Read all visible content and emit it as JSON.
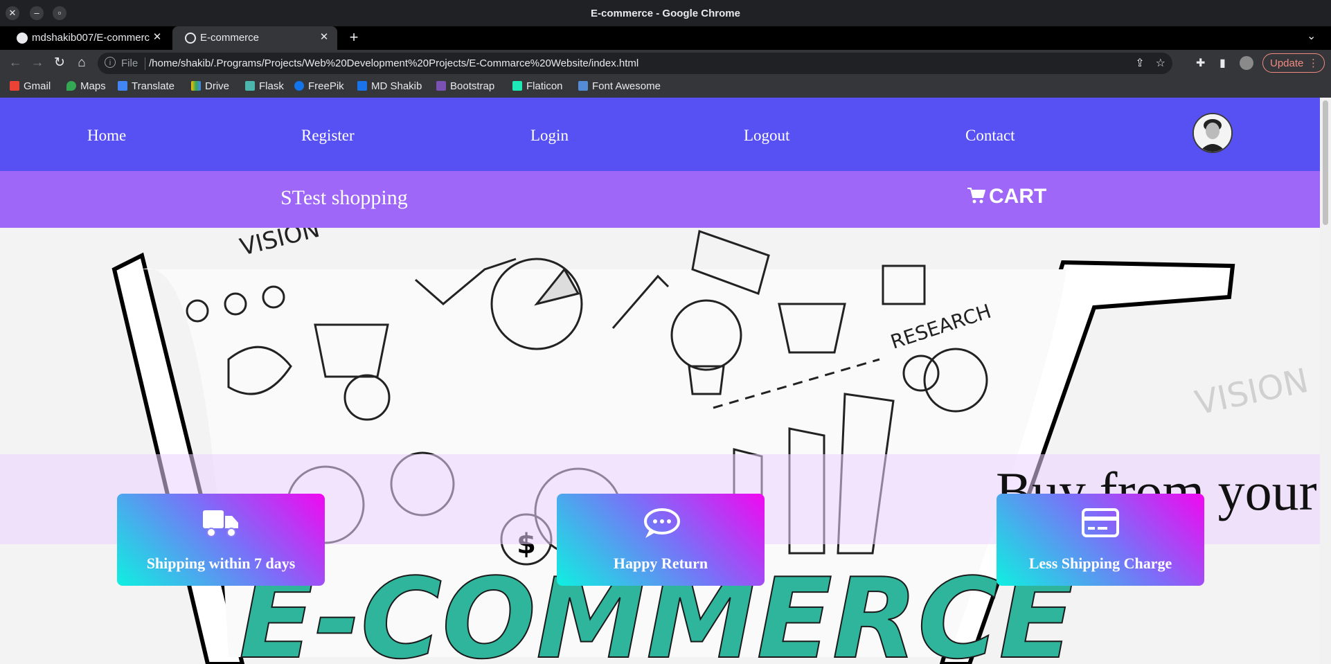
{
  "window": {
    "title": "E-commerce - Google Chrome"
  },
  "tabs": [
    {
      "label": "mdshakib007/E-commerc",
      "active": false
    },
    {
      "label": "E-commerce",
      "active": true
    }
  ],
  "omnibox": {
    "scheme_label": "File",
    "url": "/home/shakib/.Programs/Projects/Web%20Development%20Projects/E-Commarce%20Website/index.html"
  },
  "update_label": "Update",
  "bookmarks": [
    "Gmail",
    "Maps",
    "Translate",
    "Drive",
    "Flask",
    "FreePik",
    "MD Shakib",
    "Bootstrap",
    "Flaticon",
    "Font Awesome"
  ],
  "site": {
    "nav": {
      "home": "Home",
      "register": "Register",
      "login": "Login",
      "logout": "Logout",
      "contact": "Contact"
    },
    "shop_name": "STest shopping",
    "cart_label": "CART",
    "banner_text": "Buy from your",
    "hero_word": "E-COMMERCE",
    "hero_research": "RESEARCH",
    "hero_vision": "VISION",
    "features": [
      {
        "label": "Shipping within 7 days",
        "icon": "truck-icon"
      },
      {
        "label": "Happy Return",
        "icon": "chat-bubble-icon"
      },
      {
        "label": "Less Shipping Charge",
        "icon": "credit-card-icon"
      }
    ]
  },
  "colors": {
    "navbar": "#5751f3",
    "subbar": "#9e67f7",
    "feature_gradient": [
      "#0ff0e0",
      "#7b6ff8",
      "#f108f0"
    ],
    "hero_teal": "#2fb59b"
  }
}
